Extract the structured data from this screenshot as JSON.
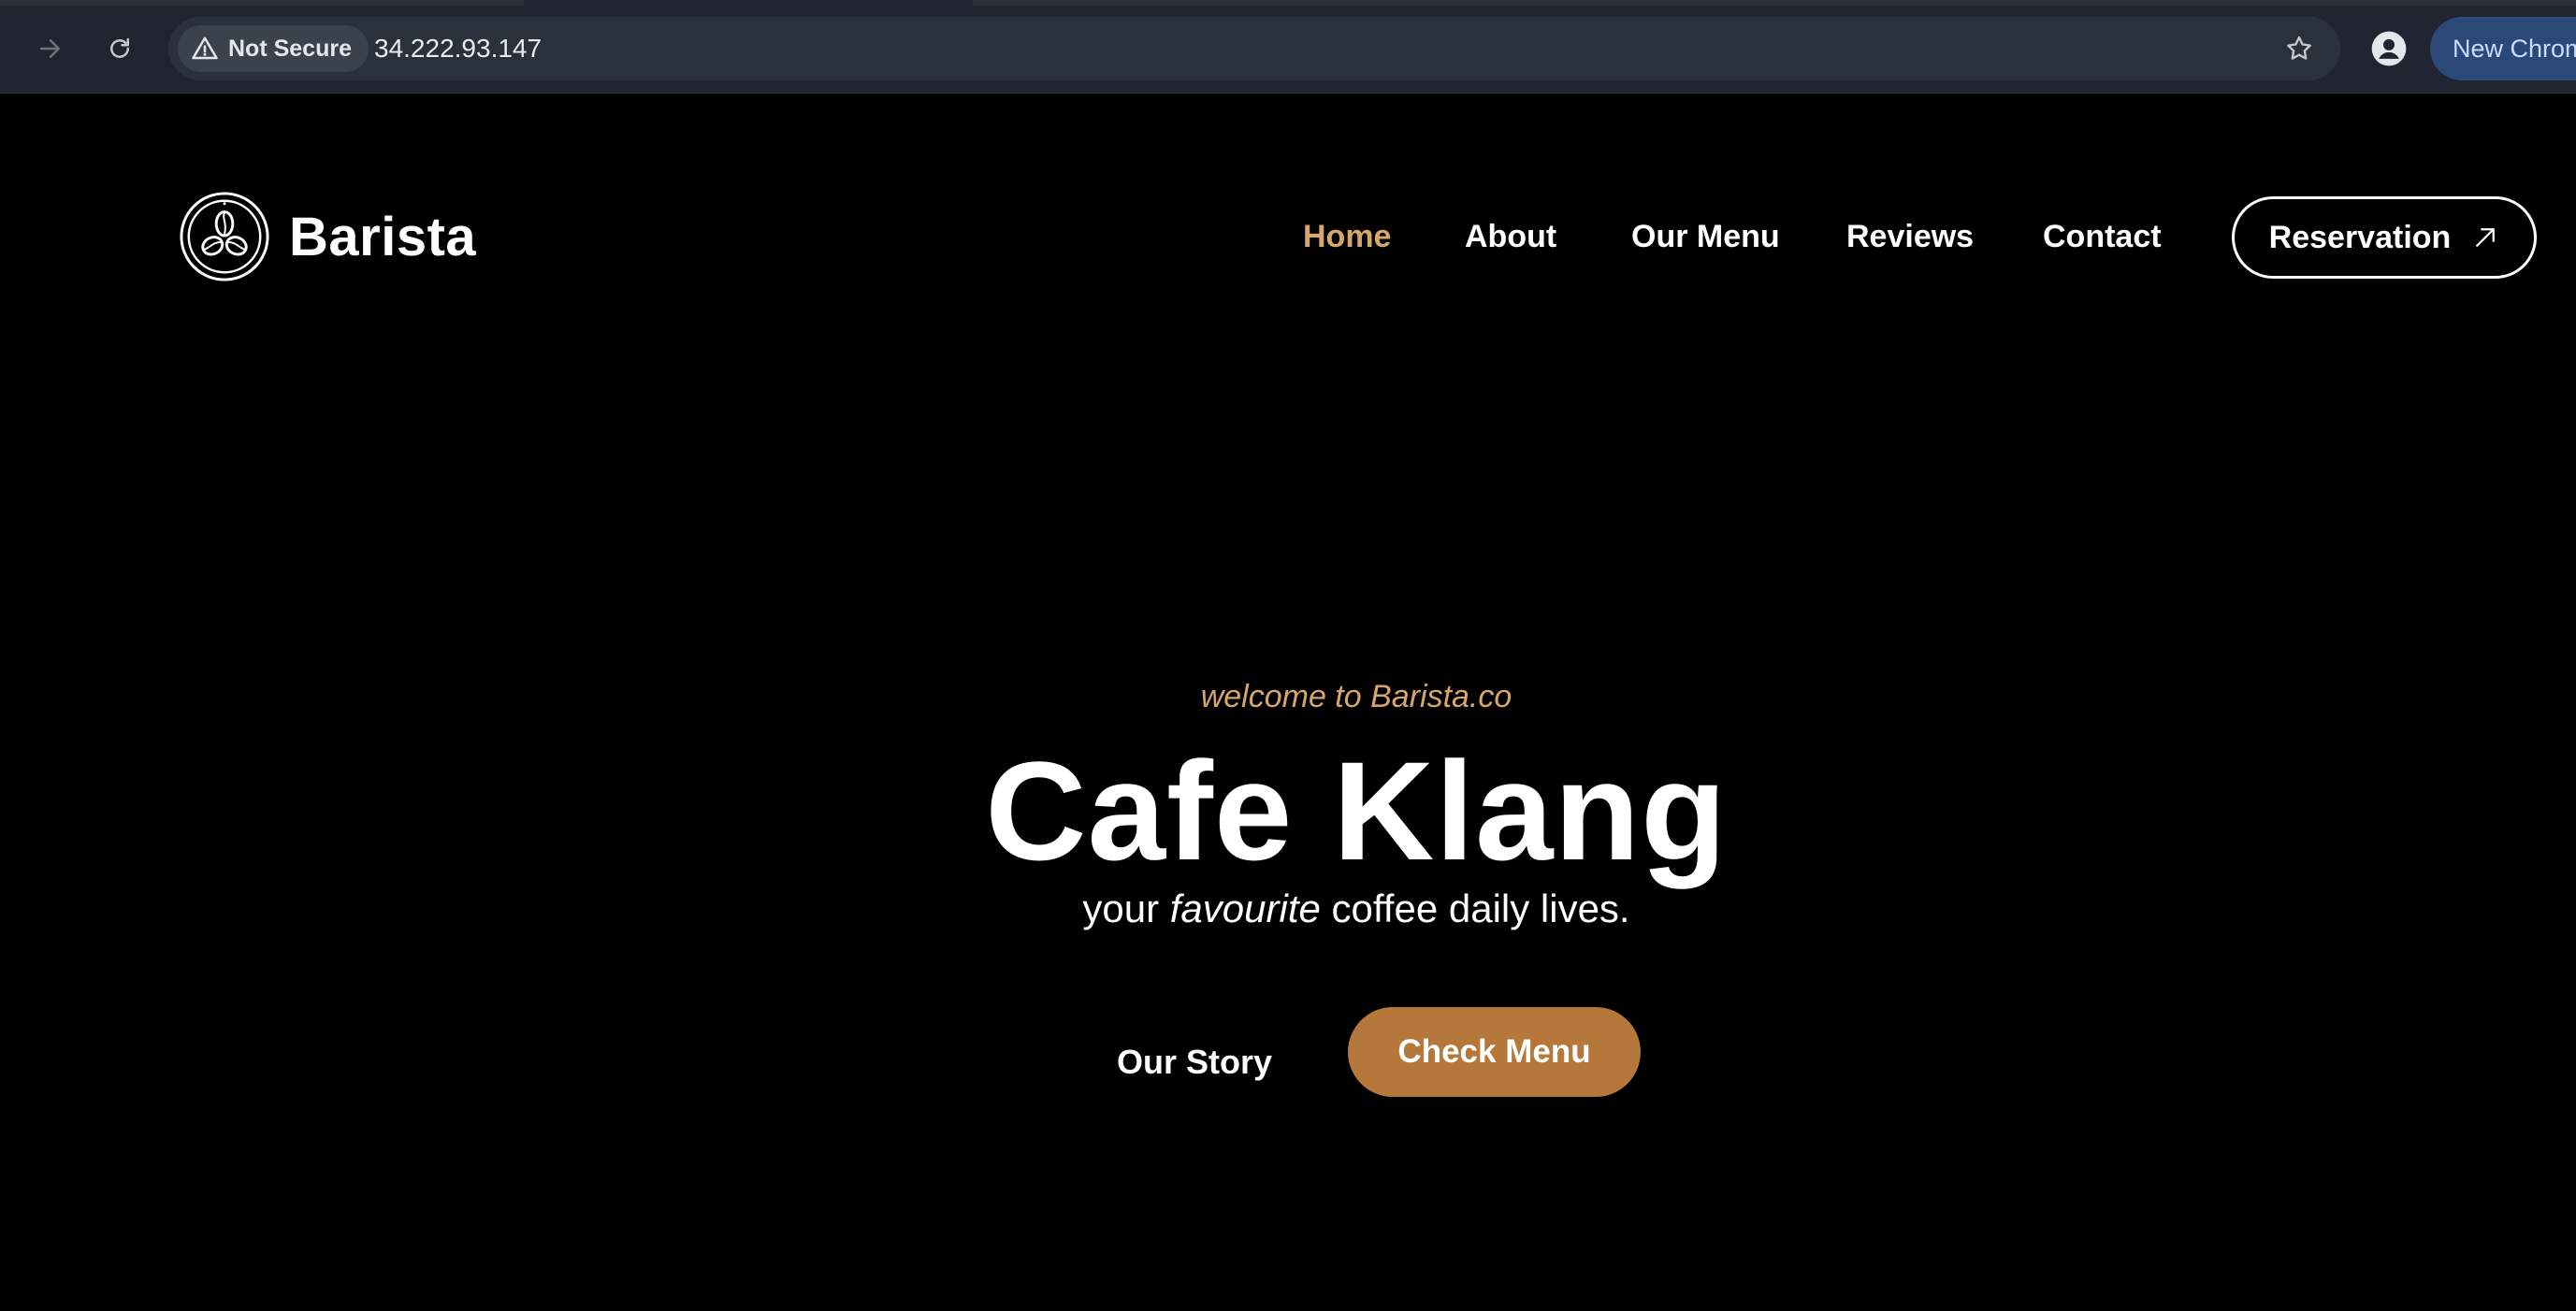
{
  "browser": {
    "security_label": "Not Secure",
    "url": "34.222.93.147",
    "new_chrome_label": "New Chrom",
    "icons": {
      "forward": "forward-arrow-icon",
      "reload": "reload-icon",
      "warning": "warning-triangle-icon",
      "bookmark": "star-icon",
      "profile": "profile-icon"
    }
  },
  "header": {
    "brand_name": "Barista",
    "logo_icon": "coffee-beans-logo",
    "nav": [
      {
        "label": "Home",
        "active": true
      },
      {
        "label": "About",
        "active": false
      },
      {
        "label": "Our Menu",
        "active": false
      },
      {
        "label": "Reviews",
        "active": false
      },
      {
        "label": "Contact",
        "active": false
      }
    ],
    "reservation_label": "Reservation",
    "reservation_icon": "arrow-up-right-icon"
  },
  "hero": {
    "welcome": "welcome to Barista.co",
    "title": "Cafe Klang",
    "subtitle_prefix": "your",
    "subtitle_emphasis": "favourite",
    "subtitle_suffix": "coffee daily lives.",
    "story_label": "Our Story",
    "menu_button_label": "Check Menu"
  },
  "colors": {
    "accent": "#d7a66c",
    "button": "#b5783a",
    "background": "#000000",
    "chrome": "#1f2430"
  }
}
